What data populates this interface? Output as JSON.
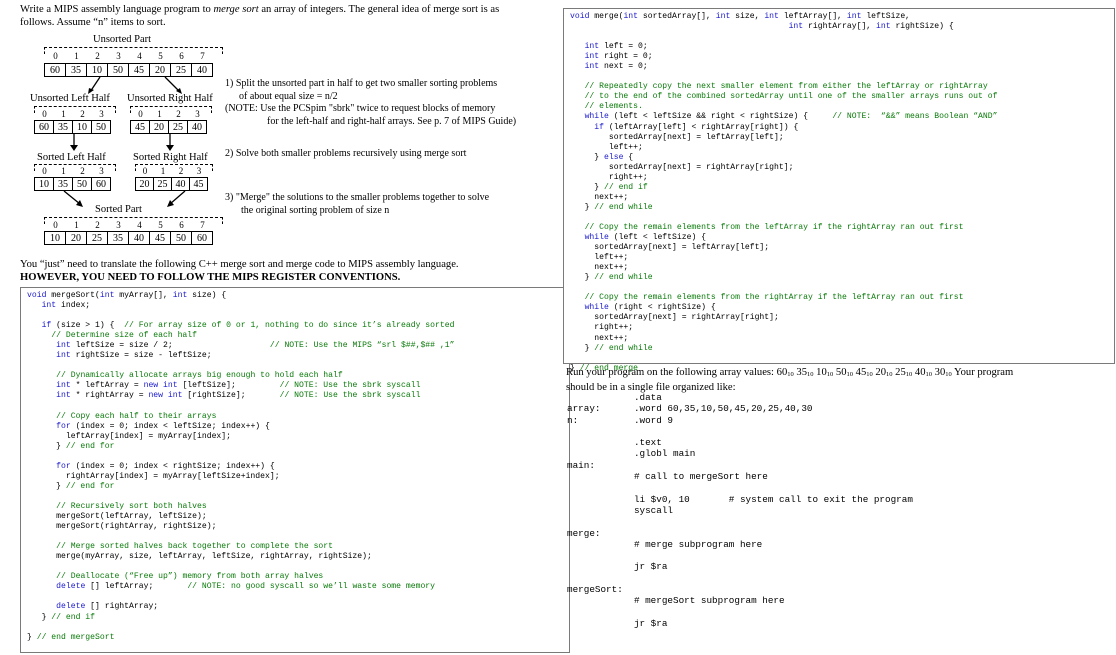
{
  "intro": {
    "line1_a": "Write a MIPS assembly language program to ",
    "line1_b": "merge sort",
    "line1_c": " an array of integers.  The general idea of merge sort is as",
    "line2": "follows.  Assume “n” items to sort."
  },
  "diagram": {
    "unsorted_title": "Unsorted Part",
    "unsorted_idx": [
      "0",
      "1",
      "2",
      "3",
      "4",
      "5",
      "6",
      "7"
    ],
    "unsorted_vals": [
      "60",
      "35",
      "10",
      "50",
      "45",
      "20",
      "25",
      "40"
    ],
    "left_title": "Unsorted Left Half",
    "left_idx": [
      "0",
      "1",
      "2",
      "3"
    ],
    "left_vals": [
      "60",
      "35",
      "10",
      "50"
    ],
    "right_title": "Unsorted Right Half",
    "right_idx": [
      "0",
      "1",
      "2",
      "3"
    ],
    "right_vals": [
      "45",
      "20",
      "25",
      "40"
    ],
    "sleft_title": "Sorted Left Half",
    "sleft_vals": [
      "10",
      "35",
      "50",
      "60"
    ],
    "sright_title": "Sorted Right Half",
    "sright_vals": [
      "20",
      "25",
      "40",
      "45"
    ],
    "sorted_title": "Sorted Part",
    "sorted_vals": [
      "10",
      "20",
      "25",
      "35",
      "40",
      "45",
      "50",
      "60"
    ]
  },
  "steps": {
    "s1_a": "1) Split the unsorted part in half to get two smaller sorting problems",
    "s1_b": "of about equal size = n/2",
    "s1_c": "(NOTE:  Use the PCSpim \"sbrk\" twice to request blocks of memory",
    "s1_d": "for the left-half and right-half arrays.  See p. 7 of MIPS Guide)",
    "s2": "2) Solve both smaller problems recursively using merge sort",
    "s3_a": "3)  \"Merge\" the solutions to the smaller problems together to solve",
    "s3_b": "the original sorting problem of size n"
  },
  "translate": {
    "line1": "You “just” need to translate the following C++ merge sort and merge code to MIPS assembly language.",
    "line2": "HOWEVER, YOU NEED TO FOLLOW THE MIPS REGISTER CONVENTIONS."
  },
  "run": {
    "line1": "Run your program on the following array values:  60",
    "sub": "10",
    "vals": [
      "35",
      "10",
      "50",
      "45",
      "20",
      "25",
      "40",
      "30"
    ],
    "line2": "  Your program",
    "line3": "should be in a single file organized like:"
  },
  "asm_lines": [
    "            .data",
    "array:      .word 60,35,10,50,45,20,25,40,30",
    "n:          .word 9",
    "",
    "            .text",
    "            .globl main",
    "main:",
    "            # call to mergeSort here",
    "",
    "            li $v0, 10       # system call to exit the program",
    "            syscall",
    "",
    "merge:",
    "            # merge subprogram here",
    "",
    "            jr $ra",
    "",
    "mergeSort:",
    "            # mergeSort subprogram here",
    "",
    "            jr $ra"
  ],
  "mergesort_code": [
    [
      [
        "kw",
        "void"
      ],
      [
        "tx",
        " mergeSort("
      ],
      [
        "kw",
        "int"
      ],
      [
        "tx",
        " myArray[], "
      ],
      [
        "kw",
        "int"
      ],
      [
        "tx",
        " size) {"
      ]
    ],
    [
      [
        "tx",
        "   "
      ],
      [
        "kw",
        "int"
      ],
      [
        "tx",
        " index;"
      ]
    ],
    [],
    [
      [
        "tx",
        "   "
      ],
      [
        "kw",
        "if"
      ],
      [
        "tx",
        " (size > 1) {  "
      ],
      [
        "cm",
        "// For array size of 0 or 1, nothing to do since it’s already sorted"
      ]
    ],
    [
      [
        "tx",
        "     "
      ],
      [
        "cm",
        "// Determine size of each half"
      ]
    ],
    [
      [
        "tx",
        "      "
      ],
      [
        "kw",
        "int"
      ],
      [
        "tx",
        " leftSize = size / 2;                    "
      ],
      [
        "cm",
        "// NOTE: Use the MIPS “srl $##,$## ,1”"
      ]
    ],
    [
      [
        "tx",
        "      "
      ],
      [
        "kw",
        "int"
      ],
      [
        "tx",
        " rightSize = size - leftSize;"
      ]
    ],
    [],
    [
      [
        "tx",
        "      "
      ],
      [
        "cm",
        "// Dynamically allocate arrays big enough to hold each half"
      ]
    ],
    [
      [
        "tx",
        "      "
      ],
      [
        "kw",
        "int"
      ],
      [
        "tx",
        " * leftArray = "
      ],
      [
        "kw",
        "new int"
      ],
      [
        "tx",
        " [leftSize];         "
      ],
      [
        "cm",
        "// NOTE: Use the sbrk syscall"
      ]
    ],
    [
      [
        "tx",
        "      "
      ],
      [
        "kw",
        "int"
      ],
      [
        "tx",
        " * rightArray = "
      ],
      [
        "kw",
        "new int"
      ],
      [
        "tx",
        " [rightSize];       "
      ],
      [
        "cm",
        "// NOTE: Use the sbrk syscall"
      ]
    ],
    [],
    [
      [
        "tx",
        "      "
      ],
      [
        "cm",
        "// Copy each half to their arrays"
      ]
    ],
    [
      [
        "tx",
        "      "
      ],
      [
        "kw",
        "for"
      ],
      [
        "tx",
        " (index = 0; index < leftSize; index++) {"
      ]
    ],
    [
      [
        "tx",
        "        leftArray[index] = myArray[index];"
      ]
    ],
    [
      [
        "tx",
        "      } "
      ],
      [
        "cm",
        "// end for"
      ]
    ],
    [],
    [
      [
        "tx",
        "      "
      ],
      [
        "kw",
        "for"
      ],
      [
        "tx",
        " (index = 0; index < rightSize; index++) {"
      ]
    ],
    [
      [
        "tx",
        "        rightArray[index] = myArray[leftSize+index];"
      ]
    ],
    [
      [
        "tx",
        "      } "
      ],
      [
        "cm",
        "// end for"
      ]
    ],
    [],
    [
      [
        "tx",
        "      "
      ],
      [
        "cm",
        "// Recursively sort both halves"
      ]
    ],
    [
      [
        "tx",
        "      mergeSort(leftArray, leftSize);"
      ]
    ],
    [
      [
        "tx",
        "      mergeSort(rightArray, rightSize);"
      ]
    ],
    [],
    [
      [
        "tx",
        "      "
      ],
      [
        "cm",
        "// Merge sorted halves back together to complete the sort"
      ]
    ],
    [
      [
        "tx",
        "      merge(myArray, size, leftArray, leftSize, rightArray, rightSize);"
      ]
    ],
    [],
    [
      [
        "tx",
        "      "
      ],
      [
        "cm",
        "// Deallocate (“Free up”) memory from both array halves"
      ]
    ],
    [
      [
        "tx",
        "      "
      ],
      [
        "kw",
        "delete"
      ],
      [
        "tx",
        " [] leftArray;       "
      ],
      [
        "cm",
        "// NOTE: no good syscall so we’ll waste some memory"
      ]
    ],
    [],
    [
      [
        "tx",
        "      "
      ],
      [
        "kw",
        "delete"
      ],
      [
        "tx",
        " [] rightArray;"
      ]
    ],
    [
      [
        "tx",
        "   } "
      ],
      [
        "cm",
        "// end if"
      ]
    ],
    [],
    [
      [
        "tx",
        "} "
      ],
      [
        "cm",
        "// end mergeSort"
      ]
    ]
  ],
  "merge_code": [
    [
      [
        "kw",
        "void"
      ],
      [
        "tx",
        " merge("
      ],
      [
        "kw",
        "int"
      ],
      [
        "tx",
        " sortedArray[], "
      ],
      [
        "kw",
        "int"
      ],
      [
        "tx",
        " size, "
      ],
      [
        "kw",
        "int"
      ],
      [
        "tx",
        " leftArray[], "
      ],
      [
        "kw",
        "int"
      ],
      [
        "tx",
        " leftSize,"
      ]
    ],
    [
      [
        "tx",
        "                                             "
      ],
      [
        "kw",
        "int"
      ],
      [
        "tx",
        " rightArray[], "
      ],
      [
        "kw",
        "int"
      ],
      [
        "tx",
        " rightSize) {"
      ]
    ],
    [],
    [
      [
        "tx",
        "   "
      ],
      [
        "kw",
        "int"
      ],
      [
        "tx",
        " left = 0;"
      ]
    ],
    [
      [
        "tx",
        "   "
      ],
      [
        "kw",
        "int"
      ],
      [
        "tx",
        " right = 0;"
      ]
    ],
    [
      [
        "tx",
        "   "
      ],
      [
        "kw",
        "int"
      ],
      [
        "tx",
        " next = 0;"
      ]
    ],
    [],
    [
      [
        "tx",
        "   "
      ],
      [
        "cm",
        "// Repeatedly copy the next smaller element from either the leftArray or rightArray"
      ]
    ],
    [
      [
        "tx",
        "   "
      ],
      [
        "cm",
        "// to the end of the combined sortedArray until one of the smaller arrays runs out of"
      ]
    ],
    [
      [
        "tx",
        "   "
      ],
      [
        "cm",
        "// elements."
      ]
    ],
    [
      [
        "tx",
        "   "
      ],
      [
        "kw",
        "while"
      ],
      [
        "tx",
        " (left < leftSize && right < rightSize) {     "
      ],
      [
        "cm",
        "// NOTE:  “&&” means Boolean “AND”"
      ]
    ],
    [
      [
        "tx",
        "     "
      ],
      [
        "kw",
        "if"
      ],
      [
        "tx",
        " (leftArray[left] < rightArray[right]) {"
      ]
    ],
    [
      [
        "tx",
        "        sortedArray[next] = leftArray[left];"
      ]
    ],
    [
      [
        "tx",
        "        left++;"
      ]
    ],
    [
      [
        "tx",
        "     } "
      ],
      [
        "kw",
        "else"
      ],
      [
        "tx",
        " {"
      ]
    ],
    [
      [
        "tx",
        "        sortedArray[next] = rightArray[right];"
      ]
    ],
    [
      [
        "tx",
        "        right++;"
      ]
    ],
    [
      [
        "tx",
        "     } "
      ],
      [
        "cm",
        "// end if"
      ]
    ],
    [
      [
        "tx",
        "     next++;"
      ]
    ],
    [
      [
        "tx",
        "   } "
      ],
      [
        "cm",
        "// end while"
      ]
    ],
    [],
    [
      [
        "tx",
        "   "
      ],
      [
        "cm",
        "// Copy the remain elements from the leftArray if the rightArray ran out first"
      ]
    ],
    [
      [
        "tx",
        "   "
      ],
      [
        "kw",
        "while"
      ],
      [
        "tx",
        " (left < leftSize) {"
      ]
    ],
    [
      [
        "tx",
        "     sortedArray[next] = leftArray[left];"
      ]
    ],
    [
      [
        "tx",
        "     left++;"
      ]
    ],
    [
      [
        "tx",
        "     next++;"
      ]
    ],
    [
      [
        "tx",
        "   } "
      ],
      [
        "cm",
        "// end while"
      ]
    ],
    [],
    [
      [
        "tx",
        "   "
      ],
      [
        "cm",
        "// Copy the remain elements from the rightArray if the leftArray ran out first"
      ]
    ],
    [
      [
        "tx",
        "   "
      ],
      [
        "kw",
        "while"
      ],
      [
        "tx",
        " (right < rightSize) {"
      ]
    ],
    [
      [
        "tx",
        "     sortedArray[next] = rightArray[right];"
      ]
    ],
    [
      [
        "tx",
        "     right++;"
      ]
    ],
    [
      [
        "tx",
        "     next++;"
      ]
    ],
    [
      [
        "tx",
        "   } "
      ],
      [
        "cm",
        "// end while"
      ]
    ],
    [],
    [
      [
        "tx",
        "} "
      ],
      [
        "cm",
        "// end merge"
      ]
    ]
  ]
}
